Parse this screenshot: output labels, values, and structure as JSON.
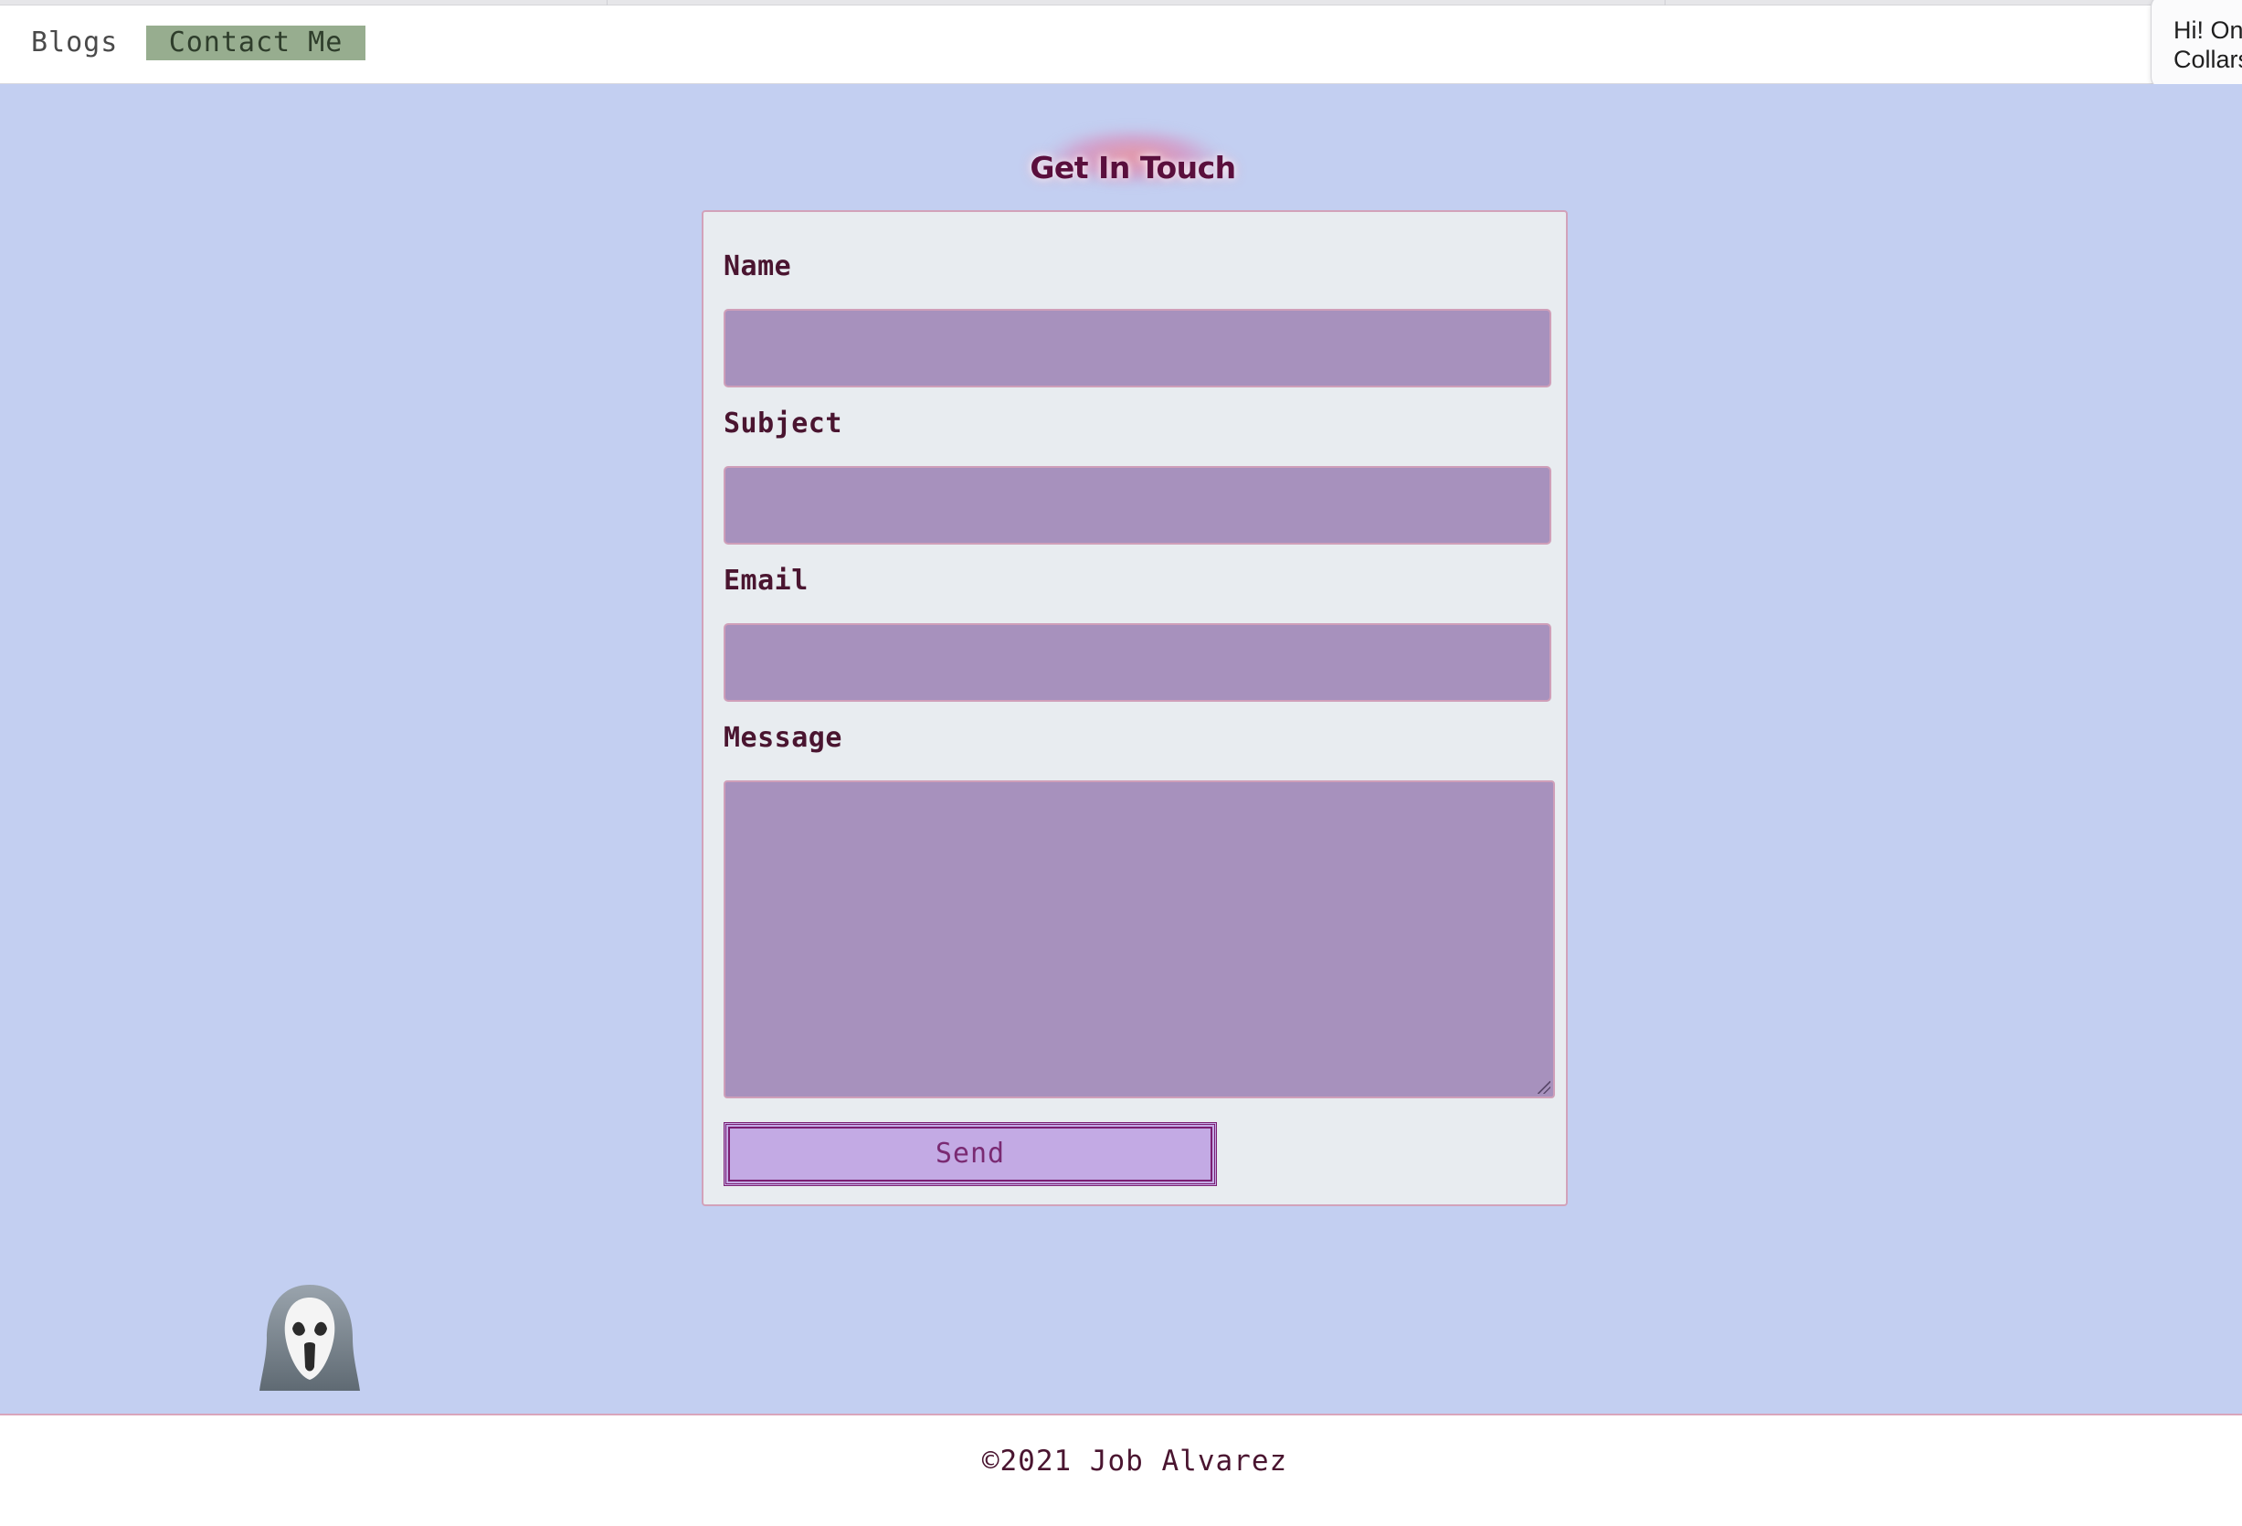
{
  "nav": {
    "items": [
      {
        "label": "Blogs"
      },
      {
        "label": "Contact Me",
        "active": true
      }
    ],
    "active_color": "#97ad8f"
  },
  "notification": {
    "line1": "Hi! On",
    "line2": "Collars"
  },
  "page": {
    "title": "Get In Touch",
    "background": "#c3cff1"
  },
  "form": {
    "fields": [
      {
        "label": "Name",
        "value": ""
      },
      {
        "label": "Subject",
        "value": ""
      },
      {
        "label": "Email",
        "value": ""
      },
      {
        "label": "Message",
        "value": ""
      }
    ],
    "submit_label": "Send",
    "field_color": "#a791bd",
    "button_color": "#c3aae4"
  },
  "decoration": {
    "icon": "ghost-scream-icon"
  },
  "footer": {
    "copyright": "©2021 Job Alvarez"
  }
}
